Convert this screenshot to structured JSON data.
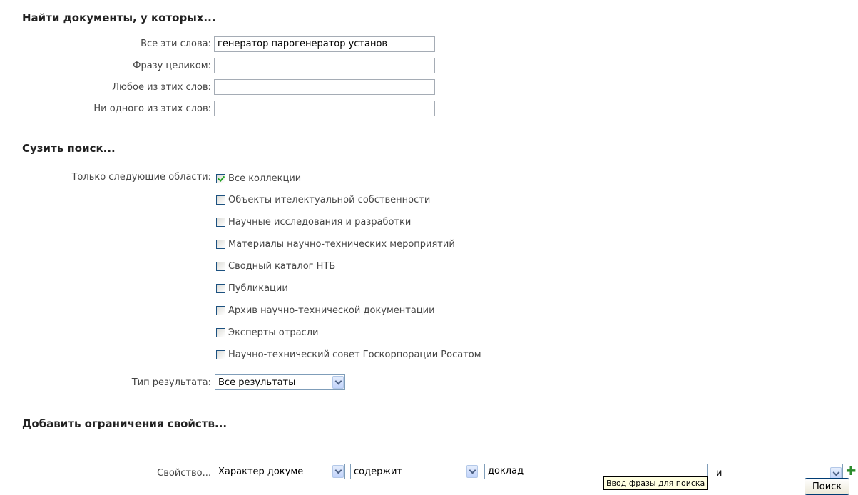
{
  "find": {
    "heading": "Найти документы, у которых...",
    "all_words_label": "Все эти слова:",
    "all_words_value": "генератор парогенератор установ",
    "phrase_label": "Фразу целиком:",
    "phrase_value": "",
    "any_words_label": "Любое из этих слов:",
    "any_words_value": "",
    "none_words_label": "Ни одного из этих слов:",
    "none_words_value": ""
  },
  "narrow": {
    "heading": "Сузить поиск...",
    "areas_label": "Только следующие области:",
    "areas": [
      {
        "label": "Все коллекции",
        "checked": true
      },
      {
        "label": "Объекты ителектуальной собственности",
        "checked": false
      },
      {
        "label": "Научные исследования и разработки",
        "checked": false
      },
      {
        "label": "Материалы научно-технических мероприятий",
        "checked": false
      },
      {
        "label": "Сводный каталог НТБ",
        "checked": false
      },
      {
        "label": "Публикации",
        "checked": false
      },
      {
        "label": "Архив научно-технической документации",
        "checked": false
      },
      {
        "label": "Эксперты отрасли",
        "checked": false
      },
      {
        "label": "Научно-технический совет Госкорпорации Росатом",
        "checked": false
      }
    ],
    "result_type_label": "Тип результата:",
    "result_type_value": "Все результаты"
  },
  "props": {
    "heading": "Добавить ограничения свойств...",
    "property_label": "Свойство...",
    "property_value": "Характер докуме",
    "operator_value": "содержит",
    "text_value": "доклад",
    "logic_value": "и",
    "tooltip": "Ввод фразы для поиска"
  },
  "search_button": "Поиск",
  "colors": {
    "checkmark": "#21a121",
    "plus": "#2c8b2c",
    "tooltip_bg": "#ffffe1"
  }
}
